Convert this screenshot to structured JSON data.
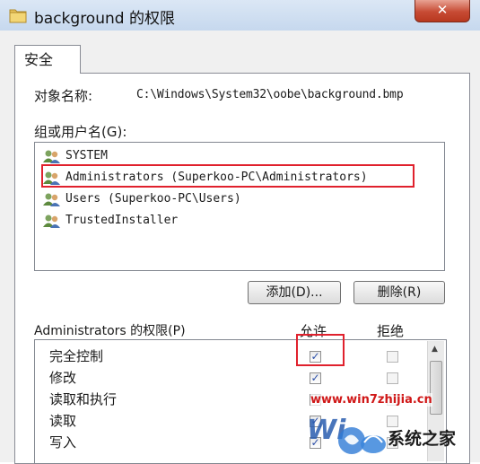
{
  "window": {
    "title": "background 的权限",
    "close_label": "✕"
  },
  "tabs": [
    {
      "label": "安全"
    }
  ],
  "object_name": {
    "label": "对象名称:",
    "value": "C:\\Windows\\System32\\oobe\\background.bmp"
  },
  "groups": {
    "label": "组或用户名(G):",
    "items": [
      {
        "name": "SYSTEM",
        "selected": false
      },
      {
        "name": "Administrators (Superkoo-PC\\Administrators)",
        "selected": true
      },
      {
        "name": "Users (Superkoo-PC\\Users)",
        "selected": false
      },
      {
        "name": "TrustedInstaller",
        "selected": false
      }
    ]
  },
  "buttons": {
    "add": "添加(D)...",
    "remove": "删除(R)"
  },
  "permissions": {
    "label": "Administrators 的权限(P)",
    "allow_header": "允许",
    "deny_header": "拒绝",
    "rows": [
      {
        "name": "完全控制",
        "allow": true,
        "deny": false
      },
      {
        "name": "修改",
        "allow": true,
        "deny": false
      },
      {
        "name": "读取和执行",
        "allow": true,
        "deny": false
      },
      {
        "name": "读取",
        "allow": true,
        "deny": false
      },
      {
        "name": "写入",
        "allow": true,
        "deny": false
      }
    ]
  },
  "watermark": {
    "url": "www.win7zhijia.cn",
    "site_name": "系统之家"
  },
  "colors": {
    "highlight_border": "#e0212d",
    "check_color": "#2b4fa8"
  }
}
